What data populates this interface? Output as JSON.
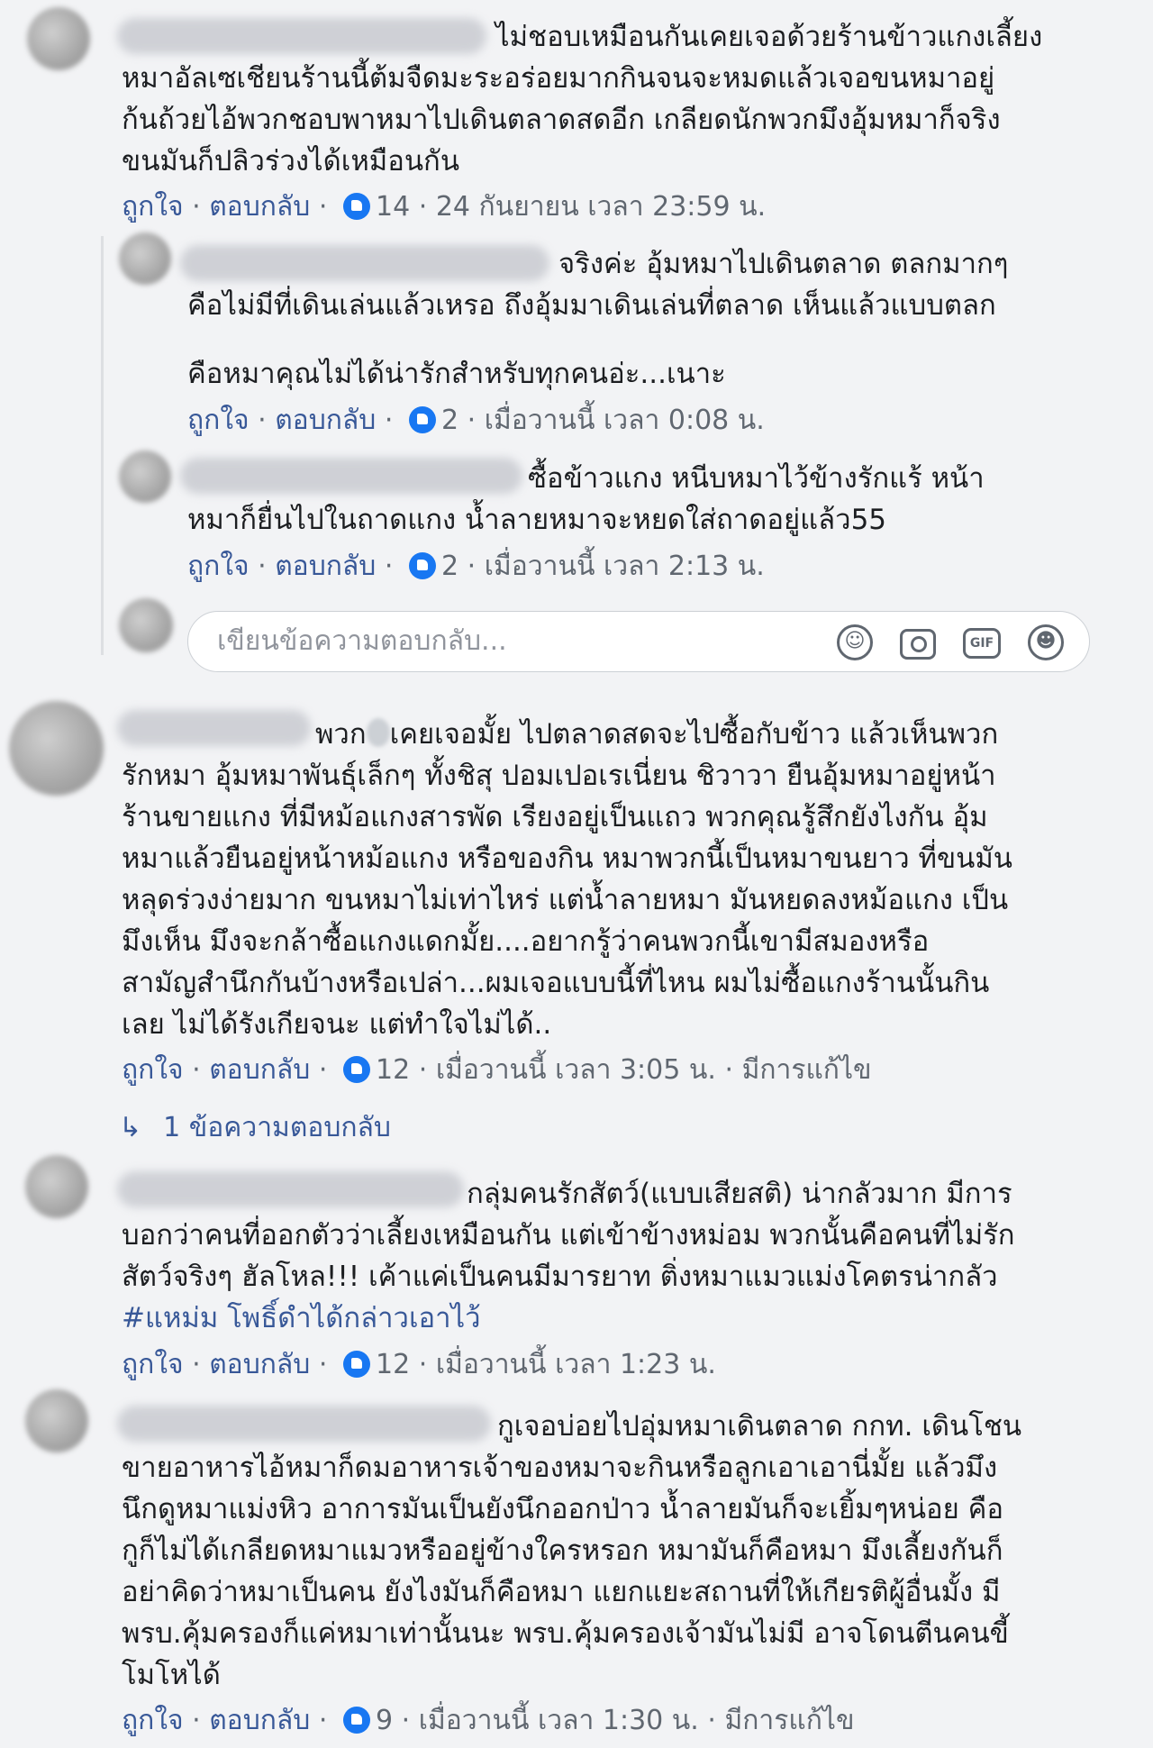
{
  "comments": [
    {
      "lines": [
        "ไม่ชอบเหมือนกันเคยเจอด้วยร้านข้าวแกงเลี้ยง",
        "หมาอัลเซเชียนร้านนี้ต้มจืดมะระอร่อยมากกินจนจะหมดแล้วเจอขนหมาอยู่",
        "ก้นถ้วยไอ้พวกชอบพาหมาไปเดินตลาดสดอีก เกลียดนักพวกมึงอุ้มหมาก็จริง",
        "ขนมันก็ปลิวร่วงได้เหมือนกัน"
      ],
      "like": "ถูกใจ",
      "reply": "ตอบกลับ",
      "reactions": "14",
      "time": "24 กันยายน เวลา 23:59 น."
    },
    {
      "lines": [
        "จริงค่ะ อุ้มหมาไปเดินตลาด ตลกมากๆ",
        "คือไม่มีที่เดินเล่นแล้วเหรอ ถึงอุ้มมาเดินเล่นที่ตลาด เห็นแล้วแบบตลก",
        "คือหมาคุณไม่ได้น่ารักสำหรับทุกคนอ่ะ...เนาะ"
      ],
      "like": "ถูกใจ",
      "reply": "ตอบกลับ",
      "reactions": "2",
      "time": "เมื่อวานนี้ เวลา 0:08 น."
    },
    {
      "lines": [
        "ซื้อข้าวแกง หนีบหมาไว้ข้างรักแร้ หน้า",
        "หมาก็ยื่นไปในถาดแกง น้ำลายหมาจะหยดใส่ถาดอยู่แล้ว55"
      ],
      "like": "ถูกใจ",
      "reply": "ตอบกลับ",
      "reactions": "2",
      "time": "เมื่อวานนี้ เวลา 2:13 น."
    },
    {
      "lines_first_a": "พวก",
      "lines_first_b": "เคยเจอมั้ย ไปตลาดสดจะไปซื้อกับข้าว แล้วเห็นพวก",
      "lines": [
        "รักหมา อุ้มหมาพันธุ์เล็กๆ ทั้งชิสุ ปอมเปอเรเนี่ยน ชิวาวา ยืนอุ้มหมาอยู่หน้า",
        "ร้านขายแกง ที่มีหม้อแกงสารพัด เรียงอยู่เป็นแถว พวกคุณรู้สึกยังไงกัน อุ้ม",
        "หมาแล้วยืนอยู่หน้าหม้อแกง หรือของกิน หมาพวกนี้เป็นหมาขนยาว ที่ขนมัน",
        "หลุดร่วงง่ายมาก ขนหมาไม่เท่าไหร่ แต่น้ำลายหมา มันหยดลงหม้อแกง เป็น",
        "มึงเห็น มึงจะกล้าซื้อแกงแดกมั้ย....อยากรู้ว่าคนพวกนี้เขามีสมองหรือ",
        "สามัญสำนึกกันบ้างหรือเปล่า...ผมเจอแบบนี้ที่ไหน ผมไม่ซื้อแกงร้านนั้นกิน",
        "เลย ไม่ได้รังเกียจนะ แต่ทำใจไม่ได้.."
      ],
      "like": "ถูกใจ",
      "reply": "ตอบกลับ",
      "reactions": "12",
      "time": "เมื่อวานนี้ เวลา 3:05 น.",
      "edited": "มีการแก้ไข"
    },
    {
      "lines": [
        "กลุ่มคนรักสัตว์(แบบเสียสติ) น่ากลัวมาก มีการ",
        "บอกว่าคนที่ออกตัวว่าเลี้ยงเหมือนกัน แต่เข้าข้างหม่อม พวกนั้นคือคนที่ไม่รัก",
        "สัตว์จริงๆ ฮัลโหล!!! เค้าแค่เป็นคนมีมารยาท ติ่งหมาแมวแม่งโคตรน่ากลัว"
      ],
      "hashtag": "#แหม่ม โพธิ์ดำได้กล่าวเอาไว้",
      "like": "ถูกใจ",
      "reply": "ตอบกลับ",
      "reactions": "12",
      "time": "เมื่อวานนี้ เวลา 1:23 น."
    },
    {
      "lines": [
        "กูเจอบ่อยไปอุ่มหมาเดินตลาด กกท. เดินโชน",
        "ขายอาหารไอ้หมาก็ดมอาหารเจ้าของหมาจะกินหรือลูกเอาเอานี่มั้ย แล้วมึง",
        "นึกดูหมาแม่งหิว อาการมันเป็นยังนึกออกป่าว น้ำลายมันก็จะเยิ้มๆหน่อย คือ",
        "กูก็ไม่ได้เกลียดหมาแมวหรืออยู่ข้างใครหรอก หมามันก็คือหมา มึงเลี้ยงกันก็",
        "อย่าคิดว่าหมาเป็นคน ยังไงมันก็คือหมา แยกแยะสถานที่ให้เกียรติผู้อื่นมั้ง มี",
        "พรบ.คุ้มครองก็แค่หมาเท่านั้นนะ พรบ.คุ้มครองเจ้ามันไม่มี อาจโดนตีนคนขี้",
        "โมโหได้"
      ],
      "like": "ถูกใจ",
      "reply": "ตอบกลับ",
      "reactions": "9",
      "time": "เมื่อวานนี้ เวลา 1:30 น.",
      "edited": "มีการแก้ไข"
    }
  ],
  "reply_box": {
    "placeholder": "เขียนข้อความตอบกลับ...",
    "icons": [
      "smiley-icon",
      "camera-icon",
      "gif-icon",
      "sticker-icon"
    ],
    "gif_label": "GIF"
  },
  "more_replies": {
    "arrow": "↳",
    "label": "1 ข้อความตอบกลับ"
  },
  "separator": "·",
  "colors": {
    "link": "#385898",
    "meta": "#606770",
    "like_blue": "#1877f2",
    "background": "#f2f3f5"
  }
}
